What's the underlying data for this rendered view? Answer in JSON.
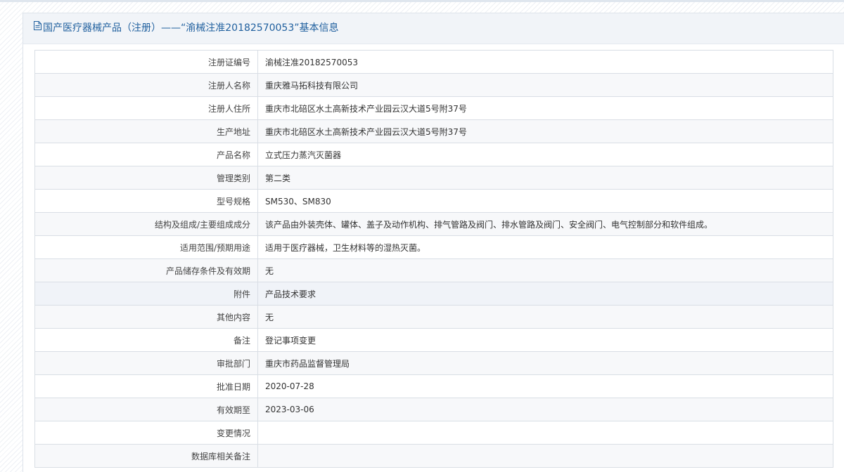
{
  "header": {
    "title": "国产医疗器械产品（注册）——“渝械注准20182570053”基本信息",
    "icon": "document-icon"
  },
  "colors": {
    "header_text": "#1f5f9e",
    "header_bg": "#f1f4f8",
    "border": "#d9dee5",
    "row_alt": "#f7f8fa"
  },
  "rows": [
    {
      "label": "注册证编号",
      "value": "渝械注准20182570053"
    },
    {
      "label": "注册人名称",
      "value": "重庆雅马拓科技有限公司"
    },
    {
      "label": "注册人住所",
      "value": "重庆市北碚区水土高新技术产业园云汉大道5号附37号"
    },
    {
      "label": "生产地址",
      "value": "重庆市北碚区水土高新技术产业园云汉大道5号附37号"
    },
    {
      "label": "产品名称",
      "value": "立式压力蒸汽灭菌器"
    },
    {
      "label": "管理类别",
      "value": "第二类"
    },
    {
      "label": "型号规格",
      "value": "SM530、SM830"
    },
    {
      "label": "结构及组成/主要组成成分",
      "value": "该产品由外装壳体、罐体、盖子及动作机构、排气管路及阀门、排水管路及阀门、安全阀门、电气控制部分和软件组成。"
    },
    {
      "label": "适用范围/预期用途",
      "value": "适用于医疗器械，卫生材料等的湿热灭菌。"
    },
    {
      "label": "产品储存条件及有效期",
      "value": "无"
    },
    {
      "label": "附件",
      "value": "产品技术要求"
    },
    {
      "label": "其他内容",
      "value": "无"
    },
    {
      "label": "备注",
      "value": "登记事项变更"
    },
    {
      "label": "审批部门",
      "value": "重庆市药品监督管理局"
    },
    {
      "label": "批准日期",
      "value": "2020-07-28"
    },
    {
      "label": "有效期至",
      "value": "2023-03-06"
    },
    {
      "label": "变更情况",
      "value": ""
    },
    {
      "label": "数据库相关备注",
      "value": ""
    }
  ]
}
